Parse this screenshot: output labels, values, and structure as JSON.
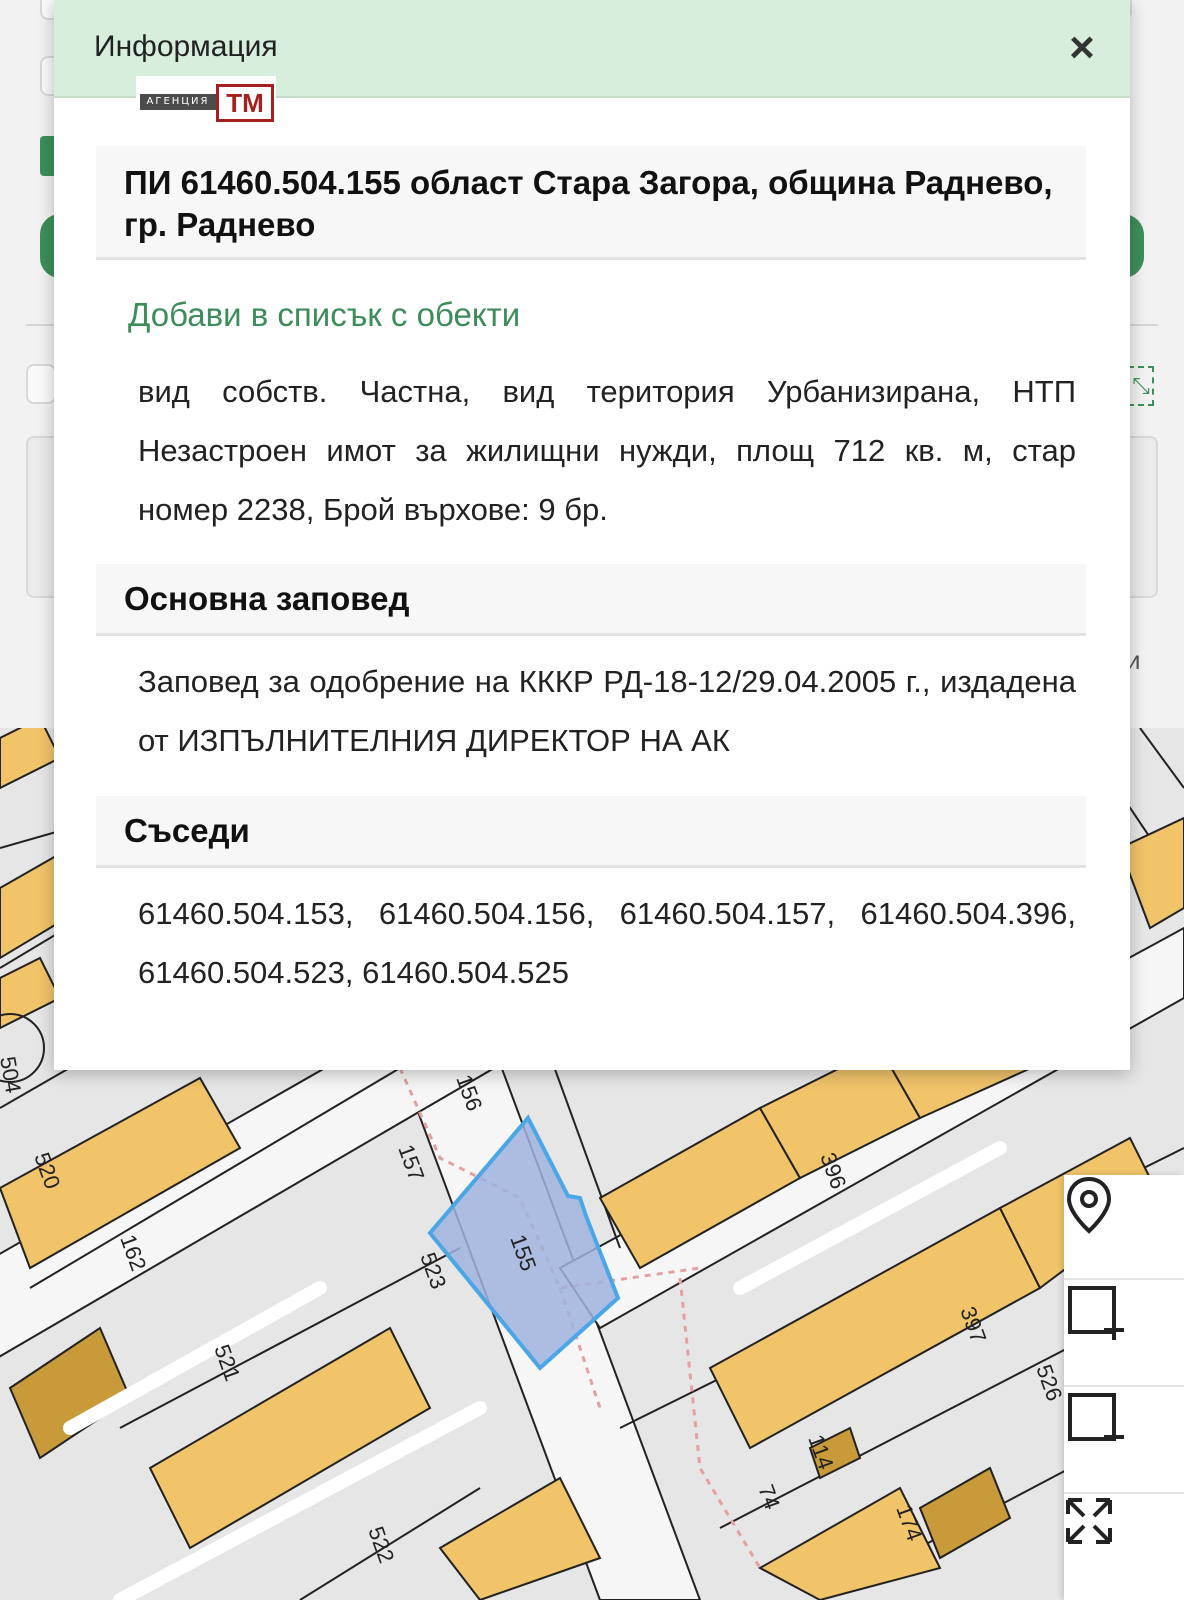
{
  "dialog": {
    "title": "Информация",
    "close_symbol": "×",
    "logo": {
      "small_text": "АГЕНЦИЯ",
      "badge_text": "ТМ"
    },
    "property_heading": "ПИ 61460.504.155 област Стара Загора, община Раднево, гр. Раднево",
    "add_link": "Добави в списък с обекти",
    "description": "вид собств. Частна, вид територия Урбанизирана, НТП Незастроен имот за жилищни нужди, площ 712 кв. м, стар номер 2238, Брой върхове: 9 бр.",
    "order_heading": "Основна заповед",
    "order_text": "Заповед за одобрение на КККР РД-18-12/29.04.2005 г., издадена от ИЗПЪЛНИТЕЛНИЯ ДИРЕКТОР НА АК",
    "neighbors_heading": "Съседи",
    "neighbors_text": "61460.504.153, 61460.504.156, 61460.504.157, 61460.504.396, 61460.504.523, 61460.504.525"
  },
  "background": {
    "partial_letter": "и"
  },
  "map": {
    "labels": [
      "504",
      "520",
      "162",
      "521",
      "522",
      "523",
      "157",
      "156",
      "155",
      "396",
      "397",
      "526",
      "114",
      "174",
      "74"
    ],
    "selected_parcel": "155",
    "colors": {
      "building": "#f1c46a",
      "building_dark": "#c99a3a",
      "selection": "#9fb3dd",
      "selection_border": "#4aa6e6",
      "road": "#f4f4f4"
    }
  },
  "tools": [
    "location-pin-icon",
    "add-area-icon",
    "remove-area-icon",
    "fullscreen-icon"
  ]
}
